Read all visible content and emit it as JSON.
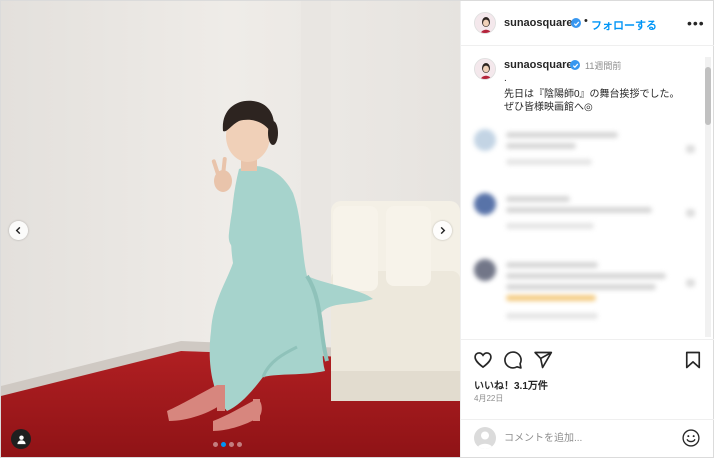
{
  "post": {
    "username": "sunaosquare",
    "follow_separator": "•",
    "follow_label": "フォローする",
    "more_label": "•••"
  },
  "caption": {
    "username": "sunaosquare",
    "time": "11週間前",
    "lines": [
      ".",
      "先日は『陰陽師0』の舞台挨拶でした。",
      "ぜひ皆様映画館へ◎"
    ]
  },
  "actions": {
    "likes_label": "いいね！3.1万件",
    "date": "4月22日"
  },
  "comment_box": {
    "placeholder": "コメントを追加..."
  },
  "carousel": {
    "slide_count": 4,
    "active_index": 1
  },
  "icons": {
    "verified": "verified-badge-icon",
    "more": "more-options-icon",
    "like": "heart-icon",
    "comment": "comment-icon",
    "share": "paper-plane-icon",
    "save": "bookmark-icon",
    "emoji": "smiley-icon",
    "user_tag": "person-icon",
    "prev": "chevron-left-icon",
    "next": "chevron-right-icon"
  },
  "colors": {
    "accent": "#0095f6",
    "verified": "#3897f0",
    "text": "#262626",
    "muted": "#8e8e8e"
  }
}
